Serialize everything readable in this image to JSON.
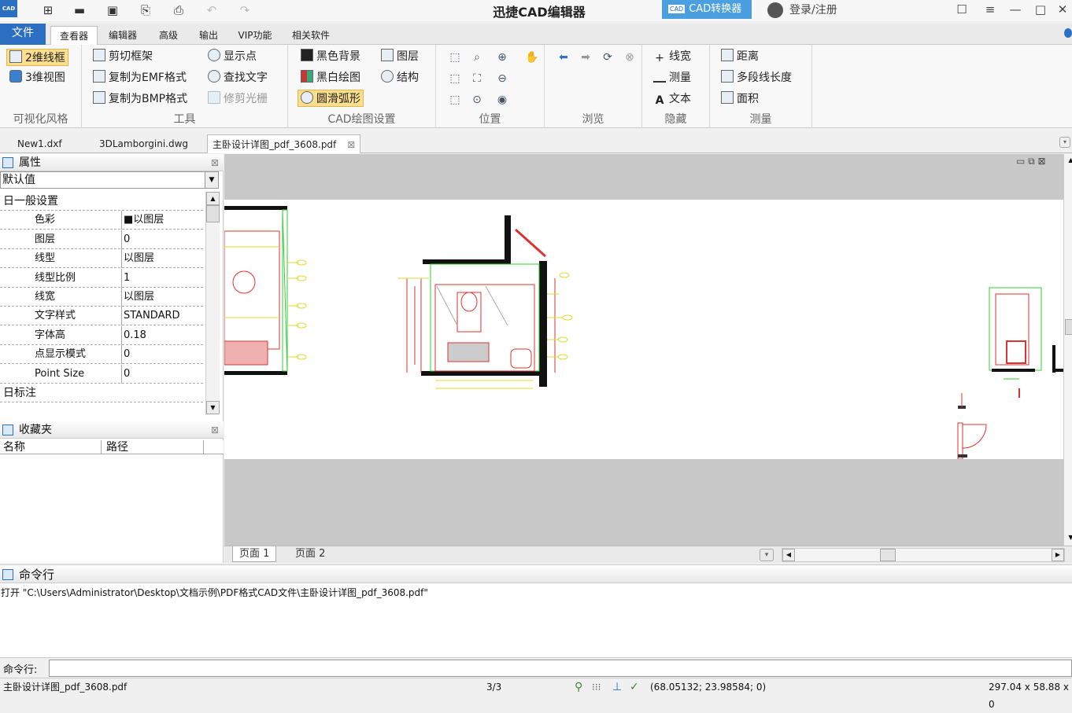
{
  "titlebar": {
    "app_icon": "CAD",
    "title": "迅捷CAD编辑器",
    "converter_icon": "CAD",
    "converter_label": "CAD转换器",
    "login_label": "登录/注册"
  },
  "ribbon_tabs": {
    "file": "文件",
    "tabs": [
      "查看器",
      "编辑器",
      "高级",
      "输出",
      "VIP功能",
      "相关软件"
    ],
    "active": "查看器"
  },
  "ribbon": {
    "visual_style": {
      "label": "可视化风格",
      "items": [
        "2维线框",
        "3维视图"
      ],
      "selected": "2维线框"
    },
    "tools": {
      "label": "工具",
      "items": [
        "剪切框架",
        "复制为EMF格式",
        "复制为BMP格式",
        "显示点",
        "查找文字",
        "修剪光栅"
      ]
    },
    "cad_settings": {
      "label": "CAD绘图设置",
      "items": [
        "黑色背景",
        "黑白绘图",
        "圆滑弧形",
        "图层",
        "结构"
      ],
      "selected": "圆滑弧形"
    },
    "position": {
      "label": "位置"
    },
    "browse": {
      "label": "浏览"
    },
    "hide": {
      "label": "隐藏",
      "items": [
        "线宽",
        "测量",
        "文本"
      ]
    },
    "measure": {
      "label": "测量",
      "items": [
        "距离",
        "多段线长度",
        "面积"
      ]
    }
  },
  "doc_tabs": [
    "New1.dxf",
    "3DLamborgini.dwg",
    "主卧设计详图_pdf_3608.pdf"
  ],
  "active_doc": "主卧设计详图_pdf_3608.pdf",
  "properties_panel": {
    "title": "属性",
    "selector": "默认值",
    "rows": [
      {
        "type": "cat",
        "name": "日一般设置"
      },
      {
        "name": "色彩",
        "value": "■以图层"
      },
      {
        "name": "图层",
        "value": "0"
      },
      {
        "name": "线型",
        "value": "以图层"
      },
      {
        "name": "线型比例",
        "value": "1"
      },
      {
        "name": "线宽",
        "value": "以图层"
      },
      {
        "name": "文字样式",
        "value": "STANDARD"
      },
      {
        "name": "字体高",
        "value": "0.18"
      },
      {
        "name": "点显示模式",
        "value": "0"
      },
      {
        "name": "Point Size",
        "value": "0"
      },
      {
        "type": "cat",
        "name": "日标注"
      }
    ]
  },
  "favorites_panel": {
    "title": "收藏夹",
    "col_name": "名称",
    "col_path": "路径"
  },
  "page_tabs": [
    "页面 1",
    "页面 2"
  ],
  "command_panel": {
    "title": "命令行",
    "log": "打开 \"C:\\Users\\Administrator\\Desktop\\文档示例\\PDF格式CAD文件\\主卧设计详图_pdf_3608.pdf\"",
    "input_label": "命令行:"
  },
  "statusbar": {
    "file": "主卧设计详图_pdf_3608.pdf",
    "page": "3/3",
    "coords": "(68.05132; 23.98584; 0)",
    "size": "297.04 x 58.88 x 0"
  }
}
